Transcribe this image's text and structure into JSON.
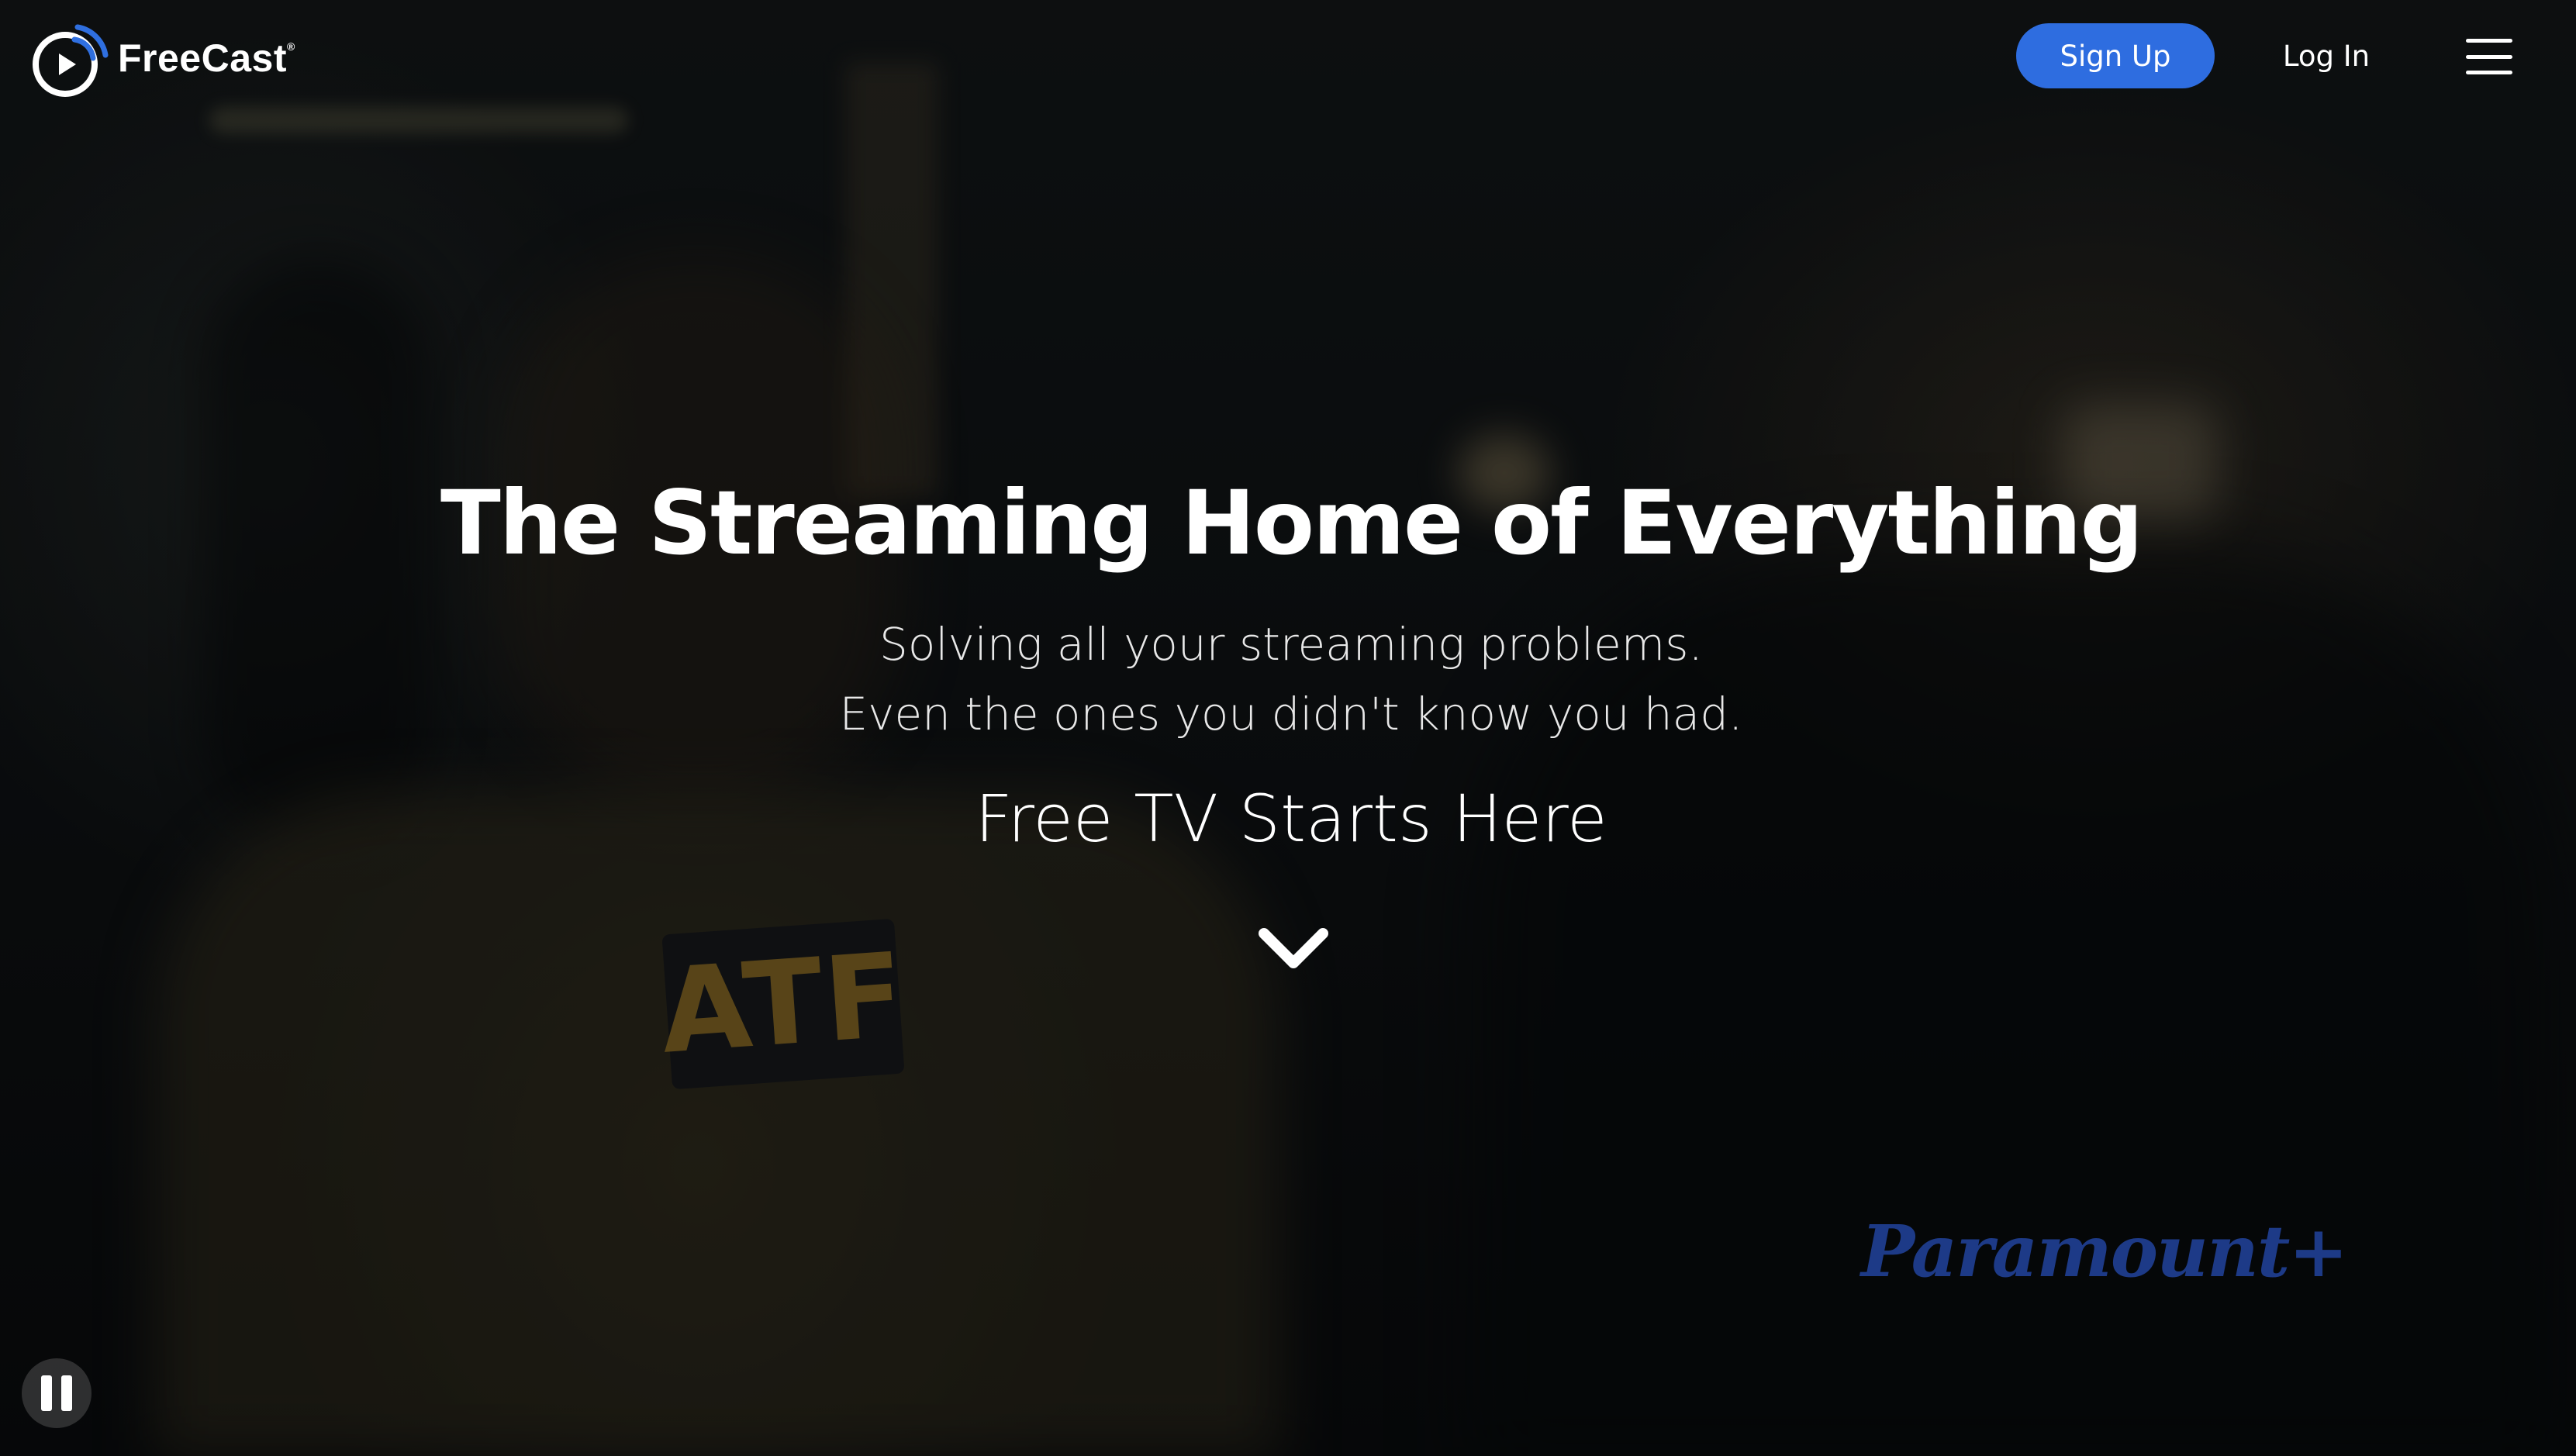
{
  "header": {
    "logo_text": "FreeCast",
    "logo_mark": "®",
    "signup_label": "Sign Up",
    "login_label": "Log In",
    "menu_icon": "hamburger-menu-icon"
  },
  "hero": {
    "title": "The Streaming Home of Everything",
    "subtitle_line1": "Solving all your streaming problems.",
    "subtitle_line2": "Even the ones you didn't know you had.",
    "cta": "Free TV Starts Here",
    "scroll_icon": "chevron-down-icon"
  },
  "video": {
    "brand_watermark": "Paramount+",
    "scene_text": "ATF",
    "control_icon": "pause-icon"
  },
  "colors": {
    "accent": "#2e6de0",
    "text": "#ffffff",
    "logo_blue": "#2f6fe0"
  }
}
